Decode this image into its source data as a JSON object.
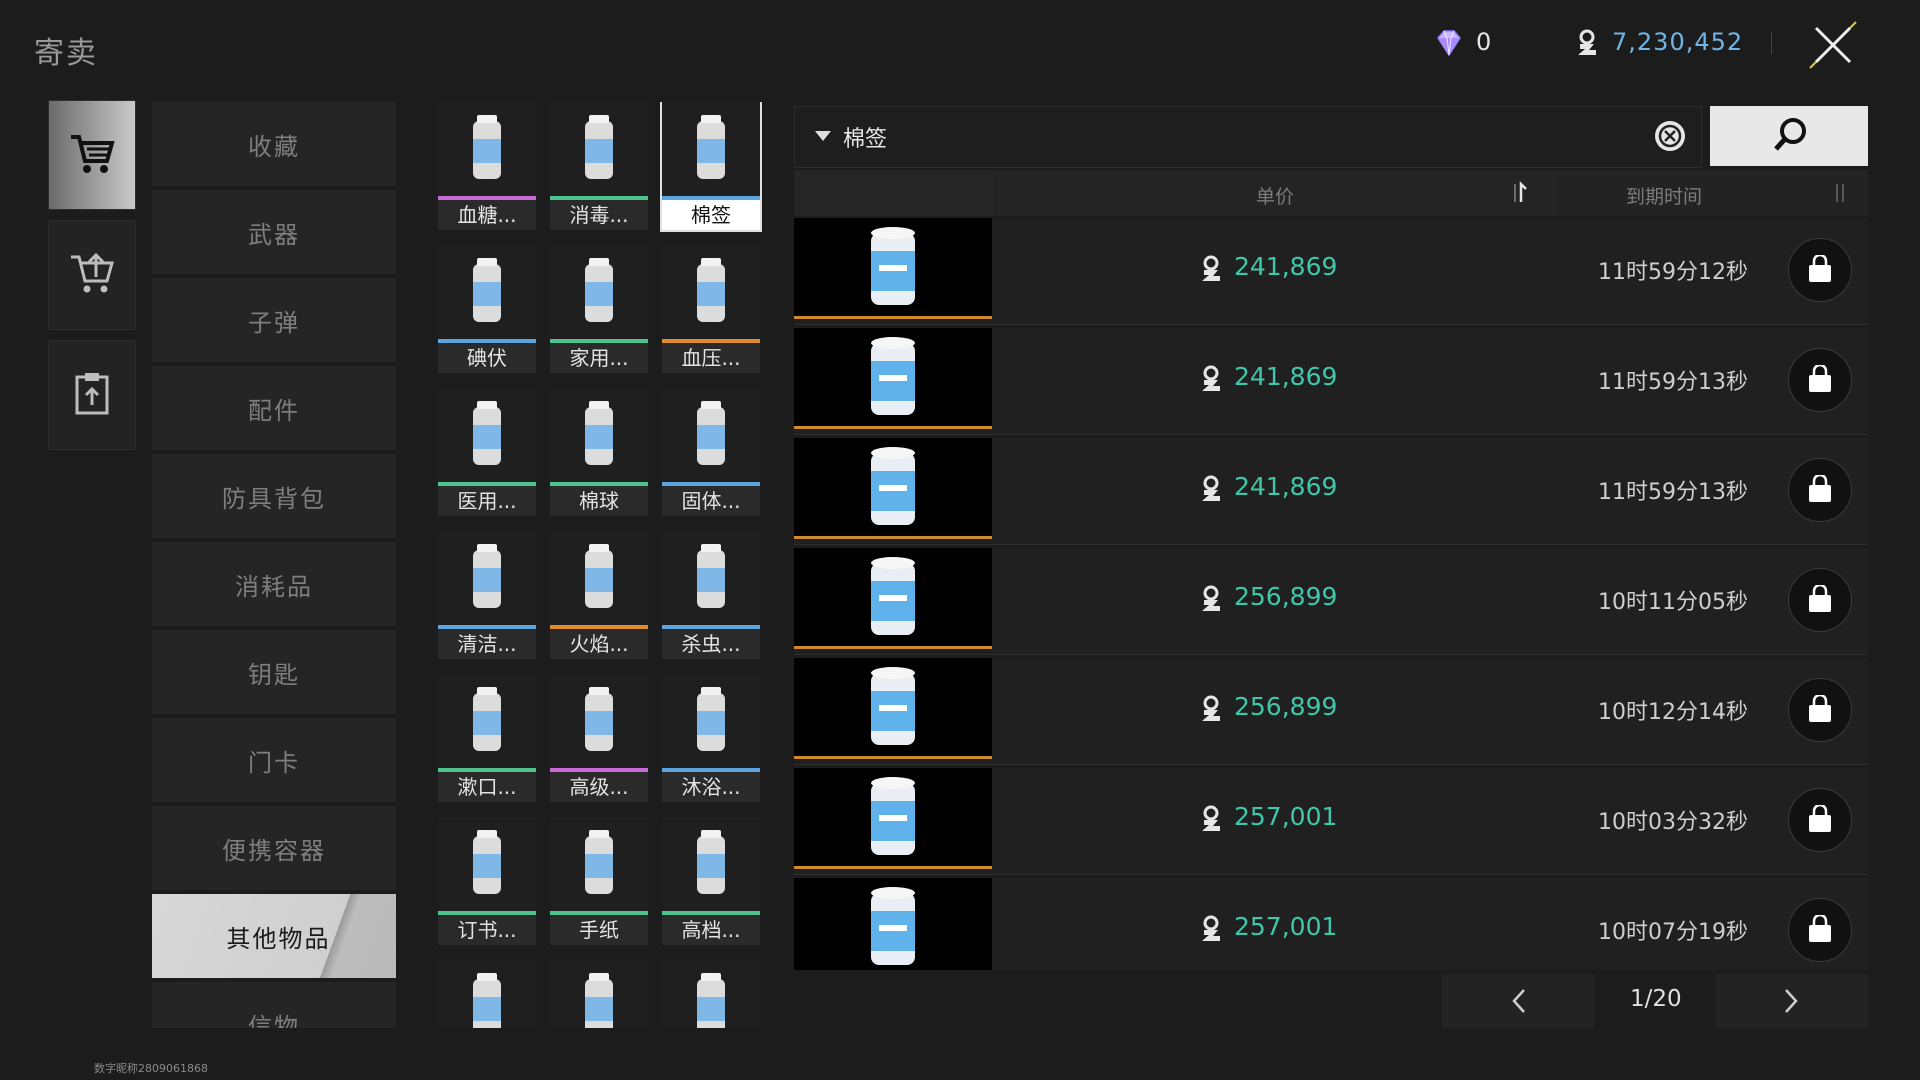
{
  "header": {
    "title": "寄卖",
    "gem_count": "0",
    "money": "7,230,452"
  },
  "mode_tabs": [
    {
      "name": "cart-icon",
      "active": true
    },
    {
      "name": "sell-cart-icon",
      "active": false
    },
    {
      "name": "clipboard-icon",
      "active": false
    }
  ],
  "categories": [
    {
      "label": "收藏"
    },
    {
      "label": "武器"
    },
    {
      "label": "子弹"
    },
    {
      "label": "配件"
    },
    {
      "label": "防具背包"
    },
    {
      "label": "消耗品"
    },
    {
      "label": "钥匙"
    },
    {
      "label": "门卡"
    },
    {
      "label": "便携容器"
    },
    {
      "label": "其他物品",
      "active": true
    },
    {
      "label": "信物"
    }
  ],
  "items": [
    {
      "label": "血糖...",
      "icon": "glucose-meter-icon",
      "rarity": "#c86bd8"
    },
    {
      "label": "消毒...",
      "icon": "disinfectant-bottle-icon",
      "rarity": "#4fc38f"
    },
    {
      "label": "棉签",
      "icon": "cotton-swab-jar-icon",
      "rarity": "#5aa4e0",
      "selected": true
    },
    {
      "label": "碘伏",
      "icon": "iodine-spray-icon",
      "rarity": "#5aa4e0"
    },
    {
      "label": "家用...",
      "icon": "household-bottle-icon",
      "rarity": "#4fc38f"
    },
    {
      "label": "血压...",
      "icon": "blood-pressure-monitor-icon",
      "rarity": "#e08a2a"
    },
    {
      "label": "医用...",
      "icon": "medical-glove-icon",
      "rarity": "#4fc38f"
    },
    {
      "label": "棉球",
      "icon": "cotton-ball-bag-icon",
      "rarity": "#4fc38f"
    },
    {
      "label": "固体...",
      "icon": "solid-cubes-icon",
      "rarity": "#5aa4e0"
    },
    {
      "label": "清洁...",
      "icon": "cleaner-bottle-icon",
      "rarity": "#5aa4e0"
    },
    {
      "label": "火焰...",
      "icon": "flame-torch-icon",
      "rarity": "#e08a2a"
    },
    {
      "label": "杀虫...",
      "icon": "insecticide-spray-icon",
      "rarity": "#5aa4e0"
    },
    {
      "label": "漱口...",
      "icon": "mouthwash-icon",
      "rarity": "#4fc38f"
    },
    {
      "label": "高级...",
      "icon": "premium-pen-icon",
      "rarity": "#c86bd8"
    },
    {
      "label": "沐浴...",
      "icon": "shower-gel-icon",
      "rarity": "#5aa4e0"
    },
    {
      "label": "订书...",
      "icon": "stapler-icon",
      "rarity": "#4fc38f"
    },
    {
      "label": "手纸",
      "icon": "toilet-paper-icon",
      "rarity": "#4fc38f"
    },
    {
      "label": "高档...",
      "icon": "lighter-icon",
      "rarity": "#4fc38f"
    },
    {
      "label": "",
      "icon": "pen-icon",
      "rarity": "#2a2a2a"
    },
    {
      "label": "",
      "icon": "green-pen-icon",
      "rarity": "#2a2a2a"
    },
    {
      "label": "",
      "icon": "razor-icon",
      "rarity": "#2a2a2a"
    }
  ],
  "filter": {
    "selected": "棉签"
  },
  "table": {
    "col_price": "单价",
    "col_time": "到期时间",
    "rows": [
      {
        "price": "241,869",
        "time": "11时59分12秒"
      },
      {
        "price": "241,869",
        "time": "11时59分13秒"
      },
      {
        "price": "241,869",
        "time": "11时59分13秒"
      },
      {
        "price": "256,899",
        "time": "10时11分05秒"
      },
      {
        "price": "256,899",
        "time": "10时12分14秒"
      },
      {
        "price": "257,001",
        "time": "10时03分32秒"
      },
      {
        "price": "257,001",
        "time": "10时07分19秒"
      }
    ]
  },
  "pager": {
    "text": "1/20"
  },
  "watermark": "数字昵称2809061868",
  "colors": {
    "price": "#3fc7a9",
    "money": "#6fb6e6",
    "row_bar": "#d08a2a"
  }
}
